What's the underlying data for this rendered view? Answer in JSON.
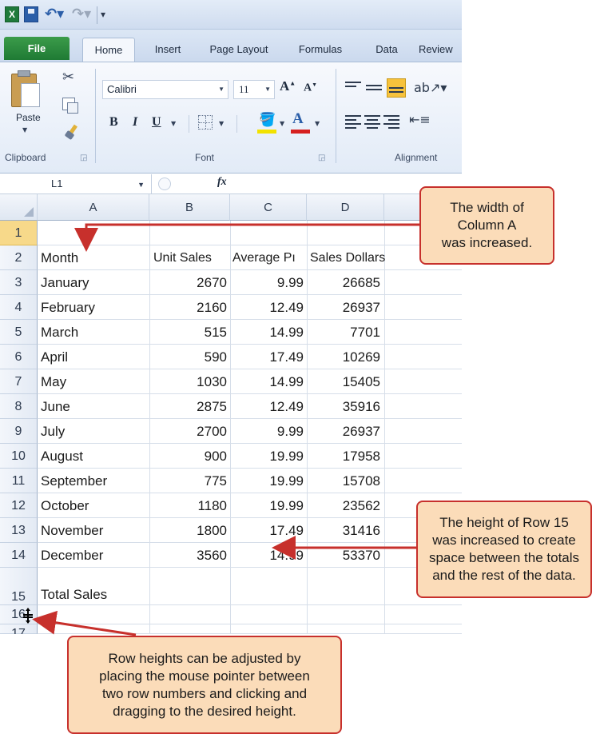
{
  "quick_access": {
    "app_icon_glyph": "X",
    "icons": [
      "excel-logo",
      "save",
      "undo",
      "redo",
      "customize"
    ]
  },
  "tabs": [
    "File",
    "Home",
    "Insert",
    "Page Layout",
    "Formulas",
    "Data",
    "Review"
  ],
  "ribbon": {
    "clipboard": {
      "label": "Clipboard",
      "paste_label": "Paste"
    },
    "font": {
      "label": "Font",
      "font_name": "Calibri",
      "font_size": "11",
      "bold": "B",
      "italic": "I",
      "underline": "U",
      "grow": "A",
      "shrink": "A",
      "font_color_glyph": "A"
    },
    "alignment": {
      "label": "Alignment"
    }
  },
  "formula_bar": {
    "name_box": "L1",
    "fx": "fx"
  },
  "sheet": {
    "columns": [
      "A",
      "B",
      "C",
      "D"
    ],
    "rows": [
      "1",
      "2",
      "3",
      "4",
      "5",
      "6",
      "7",
      "8",
      "9",
      "10",
      "11",
      "12",
      "13",
      "14",
      "15",
      "16",
      "17"
    ],
    "headers": {
      "month": "Month",
      "unit_sales": "Unit Sales",
      "average_price": "Average Pı",
      "sales_dollars": "Sales Dollars"
    },
    "data": [
      {
        "month": "January",
        "unit_sales": "2670",
        "average_price": "9.99",
        "sales_dollars": "26685"
      },
      {
        "month": "February",
        "unit_sales": "2160",
        "average_price": "12.49",
        "sales_dollars": "26937"
      },
      {
        "month": "March",
        "unit_sales": "515",
        "average_price": "14.99",
        "sales_dollars": "7701"
      },
      {
        "month": "April",
        "unit_sales": "590",
        "average_price": "17.49",
        "sales_dollars": "10269"
      },
      {
        "month": "May",
        "unit_sales": "1030",
        "average_price": "14.99",
        "sales_dollars": "15405"
      },
      {
        "month": "June",
        "unit_sales": "2875",
        "average_price": "12.49",
        "sales_dollars": "35916"
      },
      {
        "month": "July",
        "unit_sales": "2700",
        "average_price": "9.99",
        "sales_dollars": "26937"
      },
      {
        "month": "August",
        "unit_sales": "900",
        "average_price": "19.99",
        "sales_dollars": "17958"
      },
      {
        "month": "September",
        "unit_sales": "775",
        "average_price": "19.99",
        "sales_dollars": "15708"
      },
      {
        "month": "October",
        "unit_sales": "1180",
        "average_price": "19.99",
        "sales_dollars": "23562"
      },
      {
        "month": "November",
        "unit_sales": "1800",
        "average_price": "17.49",
        "sales_dollars": "31416"
      },
      {
        "month": "December",
        "unit_sales": "3560",
        "average_price": "14.99",
        "sales_dollars": "53370"
      }
    ],
    "total_label": "Total Sales"
  },
  "callouts": {
    "column_width": "The width of\nColumn A\nwas increased.",
    "row_height": "The height of Row 15\nwas increased to create\nspace between the totals\nand the rest of the data.",
    "adjust_rows": "Row heights can be adjusted by\nplacing the mouse pointer between\ntwo row numbers and clicking and\ndragging to the desired height."
  },
  "colors": {
    "callout_fill": "#fbdcb9",
    "callout_border": "#c7302c",
    "arrow": "#c7302c",
    "selected_row_header": "#f7d98a",
    "file_tab": "#1f7a34"
  }
}
